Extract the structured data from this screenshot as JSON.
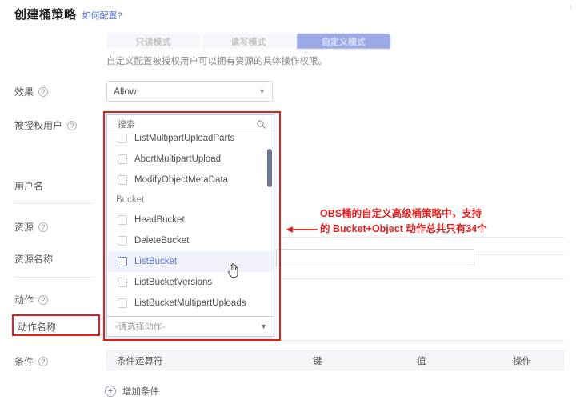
{
  "header": {
    "title": "创建桶策略",
    "howto_link": "如何配置?",
    "corner_icon": "chevron-right-icon"
  },
  "tabs": {
    "items": [
      {
        "label": "只读模式",
        "active": false
      },
      {
        "label": "读写模式",
        "active": false
      },
      {
        "label": "自定义模式",
        "active": true
      }
    ],
    "description": "自定义配置被授权用户可以拥有资源的具体操作权限。"
  },
  "form": {
    "effect": {
      "label": "效果",
      "help_icon": "question-icon",
      "value": "Allow",
      "caret_icon": "chevron-down-icon"
    },
    "principal": {
      "label": "被授权用户",
      "help_icon": "question-icon"
    },
    "username": {
      "label": "用户名"
    },
    "resource": {
      "label": "资源",
      "help_icon": "question-icon"
    },
    "resource_name": {
      "label": "资源名称",
      "value": ""
    },
    "action": {
      "label": "动作",
      "help_icon": "question-icon"
    },
    "action_name": {
      "label": "动作名称",
      "trigger_placeholder": "-请选择动作-",
      "caret_icon": "chevron-down-icon"
    },
    "condition": {
      "label": "条件",
      "help_icon": "question-icon"
    }
  },
  "action_popup": {
    "search_placeholder": "搜索",
    "search_value": "",
    "search_icon": "search-icon",
    "options": [
      {
        "label": "ListMultipartUploadParts",
        "type": "item",
        "checked": false,
        "selected": false,
        "clipped": true
      },
      {
        "label": "AbortMultipartUpload",
        "type": "item",
        "checked": false,
        "selected": false
      },
      {
        "label": "ModifyObjectMetaData",
        "type": "item",
        "checked": false,
        "selected": false
      },
      {
        "label": "Bucket",
        "type": "group"
      },
      {
        "label": "HeadBucket",
        "type": "item",
        "checked": false,
        "selected": false
      },
      {
        "label": "DeleteBucket",
        "type": "item",
        "checked": false,
        "selected": false
      },
      {
        "label": "ListBucket",
        "type": "item",
        "checked": false,
        "selected": true
      },
      {
        "label": "ListBucketVersions",
        "type": "item",
        "checked": false,
        "selected": false
      },
      {
        "label": "ListBucketMultipartUploads",
        "type": "item",
        "checked": false,
        "selected": false
      }
    ],
    "scrollbar": {
      "visible": true
    }
  },
  "annotation": {
    "note_line1": "OBS桶的自定义高级桶策略中，支持",
    "note_line2": "的 Bucket+Object 动作总共只有34个",
    "color": "#e02020",
    "arrow_icon": "arrow-left-icon",
    "highlight_popup": true,
    "highlight_action_name_label": true
  },
  "condition_table": {
    "columns": [
      "条件运算符",
      "键",
      "值",
      "操作"
    ],
    "rows": [],
    "add_button": {
      "label": "增加条件",
      "icon": "plus-circle-icon"
    }
  },
  "colors": {
    "accent": "#4a64d4",
    "link": "#526ecc",
    "annotation_red": "#e02020",
    "selected_row_bg": "#f0f3fb",
    "table_header_bg": "#f5f6fa"
  }
}
